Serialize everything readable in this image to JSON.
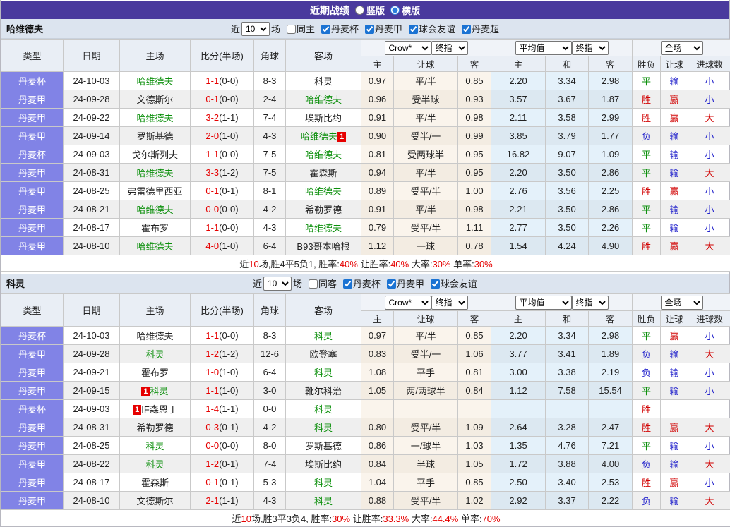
{
  "title_bar": {
    "title": "近期战绩",
    "options": [
      {
        "label": "竖版",
        "selected": false
      },
      {
        "label": "横版",
        "selected": true
      }
    ]
  },
  "colors": {
    "title_bg": "#4a3a9d",
    "section_bar_bg": "#dce4ef",
    "type_cell_bg": "#8183e6",
    "team_green": "#0b8f0b",
    "win_red": "#d10000",
    "loss_blue": "#2525cc",
    "score_red": "#e60000"
  },
  "table_header": {
    "cols": [
      "类型",
      "日期",
      "主场",
      "比分(半场)",
      "角球",
      "客场"
    ],
    "sub": [
      "主",
      "让球",
      "客",
      "主",
      "和",
      "客",
      "胜负",
      "让球",
      "进球数"
    ],
    "selects": {
      "bookmaker": "Crow*",
      "final1": "终指",
      "average": "平均值",
      "final2": "终指",
      "scope": "全场"
    }
  },
  "sections": [
    {
      "team": "哈维德夫",
      "filter": {
        "prefix": "近",
        "count": "10",
        "suffix": "场",
        "same": {
          "label": "同主",
          "checked": false
        },
        "leagues": [
          {
            "label": "丹麦杯",
            "checked": true
          },
          {
            "label": "丹麦甲",
            "checked": true
          },
          {
            "label": "球会友谊",
            "checked": true
          },
          {
            "label": "丹麦超",
            "checked": true
          }
        ]
      },
      "rows": [
        {
          "league": "丹麦杯",
          "date": "24-10-03",
          "home": "哈维德夫",
          "home_active": true,
          "home_badge_before": "",
          "home_badge_after": "",
          "score_ft": "1-1",
          "score_ht": "(0-0)",
          "corners": "8-3",
          "away": "科灵",
          "away_active": false,
          "away_badge_after": "",
          "odds": [
            "0.97",
            "平/半",
            "0.85",
            "2.20",
            "3.34",
            "2.98"
          ],
          "results": [
            {
              "text": "平",
              "color": "green"
            },
            {
              "text": "输",
              "color": "blue"
            },
            {
              "text": "小",
              "color": "blue"
            }
          ]
        },
        {
          "league": "丹麦甲",
          "date": "24-09-28",
          "home": "文德斯尔",
          "home_active": false,
          "home_badge_before": "",
          "home_badge_after": "",
          "score_ft": "0-1",
          "score_ht": "(0-0)",
          "corners": "2-4",
          "away": "哈维德夫",
          "away_active": true,
          "away_badge_after": "",
          "odds": [
            "0.96",
            "受半球",
            "0.93",
            "3.57",
            "3.67",
            "1.87"
          ],
          "results": [
            {
              "text": "胜",
              "color": "red"
            },
            {
              "text": "赢",
              "color": "red"
            },
            {
              "text": "小",
              "color": "blue"
            }
          ]
        },
        {
          "league": "丹麦甲",
          "date": "24-09-22",
          "home": "哈维德夫",
          "home_active": true,
          "home_badge_before": "",
          "home_badge_after": "",
          "score_ft": "3-2",
          "score_ht": "(1-1)",
          "corners": "7-4",
          "away": "埃斯比约",
          "away_active": false,
          "away_badge_after": "",
          "odds": [
            "0.91",
            "平/半",
            "0.98",
            "2.11",
            "3.58",
            "2.99"
          ],
          "results": [
            {
              "text": "胜",
              "color": "red"
            },
            {
              "text": "赢",
              "color": "red"
            },
            {
              "text": "大",
              "color": "red"
            }
          ]
        },
        {
          "league": "丹麦甲",
          "date": "24-09-14",
          "home": "罗斯基德",
          "home_active": false,
          "home_badge_before": "",
          "home_badge_after": "",
          "score_ft": "2-0",
          "score_ht": "(1-0)",
          "corners": "4-3",
          "away": "哈维德夫",
          "away_active": true,
          "away_badge_after": "1",
          "odds": [
            "0.90",
            "受半/一",
            "0.99",
            "3.85",
            "3.79",
            "1.77"
          ],
          "results": [
            {
              "text": "负",
              "color": "blue"
            },
            {
              "text": "输",
              "color": "blue"
            },
            {
              "text": "小",
              "color": "blue"
            }
          ]
        },
        {
          "league": "丹麦杯",
          "date": "24-09-03",
          "home": "戈尔斯列夫",
          "home_active": false,
          "home_badge_before": "",
          "home_badge_after": "",
          "score_ft": "1-1",
          "score_ht": "(0-0)",
          "corners": "7-5",
          "away": "哈维德夫",
          "away_active": true,
          "away_badge_after": "",
          "odds": [
            "0.81",
            "受两球半",
            "0.95",
            "16.82",
            "9.07",
            "1.09"
          ],
          "results": [
            {
              "text": "平",
              "color": "green"
            },
            {
              "text": "输",
              "color": "blue"
            },
            {
              "text": "小",
              "color": "blue"
            }
          ]
        },
        {
          "league": "丹麦甲",
          "date": "24-08-31",
          "home": "哈维德夫",
          "home_active": true,
          "home_badge_before": "",
          "home_badge_after": "",
          "score_ft": "3-3",
          "score_ht": "(1-2)",
          "corners": "7-5",
          "away": "霍森斯",
          "away_active": false,
          "away_badge_after": "",
          "odds": [
            "0.94",
            "平/半",
            "0.95",
            "2.20",
            "3.50",
            "2.86"
          ],
          "results": [
            {
              "text": "平",
              "color": "green"
            },
            {
              "text": "输",
              "color": "blue"
            },
            {
              "text": "大",
              "color": "red"
            }
          ]
        },
        {
          "league": "丹麦甲",
          "date": "24-08-25",
          "home": "弗雷德里西亚",
          "home_active": false,
          "home_badge_before": "",
          "home_badge_after": "",
          "score_ft": "0-1",
          "score_ht": "(0-1)",
          "corners": "8-1",
          "away": "哈维德夫",
          "away_active": true,
          "away_badge_after": "",
          "odds": [
            "0.89",
            "受平/半",
            "1.00",
            "2.76",
            "3.56",
            "2.25"
          ],
          "results": [
            {
              "text": "胜",
              "color": "red"
            },
            {
              "text": "赢",
              "color": "red"
            },
            {
              "text": "小",
              "color": "blue"
            }
          ]
        },
        {
          "league": "丹麦甲",
          "date": "24-08-21",
          "home": "哈维德夫",
          "home_active": true,
          "home_badge_before": "",
          "home_badge_after": "",
          "score_ft": "0-0",
          "score_ht": "(0-0)",
          "corners": "4-2",
          "away": "希勒罗德",
          "away_active": false,
          "away_badge_after": "",
          "odds": [
            "0.91",
            "平/半",
            "0.98",
            "2.21",
            "3.50",
            "2.86"
          ],
          "results": [
            {
              "text": "平",
              "color": "green"
            },
            {
              "text": "输",
              "color": "blue"
            },
            {
              "text": "小",
              "color": "blue"
            }
          ]
        },
        {
          "league": "丹麦甲",
          "date": "24-08-17",
          "home": "霍布罗",
          "home_active": false,
          "home_badge_before": "",
          "home_badge_after": "",
          "score_ft": "1-1",
          "score_ht": "(0-0)",
          "corners": "4-3",
          "away": "哈维德夫",
          "away_active": true,
          "away_badge_after": "",
          "odds": [
            "0.79",
            "受平/半",
            "1.11",
            "2.77",
            "3.50",
            "2.26"
          ],
          "results": [
            {
              "text": "平",
              "color": "green"
            },
            {
              "text": "输",
              "color": "blue"
            },
            {
              "text": "小",
              "color": "blue"
            }
          ]
        },
        {
          "league": "丹麦甲",
          "date": "24-08-10",
          "home": "哈维德夫",
          "home_active": true,
          "home_badge_before": "",
          "home_badge_after": "",
          "score_ft": "4-0",
          "score_ht": "(1-0)",
          "corners": "6-4",
          "away": "B93哥本哈根",
          "away_active": false,
          "away_badge_after": "",
          "odds": [
            "1.12",
            "一球",
            "0.78",
            "1.54",
            "4.24",
            "4.90"
          ],
          "results": [
            {
              "text": "胜",
              "color": "red"
            },
            {
              "text": "赢",
              "color": "red"
            },
            {
              "text": "大",
              "color": "red"
            }
          ]
        }
      ],
      "summary": [
        {
          "text": "近",
          "red": false
        },
        {
          "text": "10",
          "red": true
        },
        {
          "text": "场,胜4平5负1, 胜率:",
          "red": false
        },
        {
          "text": "40%",
          "red": true
        },
        {
          "text": " 让胜率:",
          "red": false
        },
        {
          "text": "40%",
          "red": true
        },
        {
          "text": " 大率:",
          "red": false
        },
        {
          "text": "30%",
          "red": true
        },
        {
          "text": " 单率:",
          "red": false
        },
        {
          "text": "30%",
          "red": true
        }
      ]
    },
    {
      "team": "科灵",
      "filter": {
        "prefix": "近",
        "count": "10",
        "suffix": "场",
        "same": {
          "label": "同客",
          "checked": false
        },
        "leagues": [
          {
            "label": "丹麦杯",
            "checked": true
          },
          {
            "label": "丹麦甲",
            "checked": true
          },
          {
            "label": "球会友谊",
            "checked": true
          }
        ]
      },
      "rows": [
        {
          "league": "丹麦杯",
          "date": "24-10-03",
          "home": "哈维德夫",
          "home_active": false,
          "home_badge_before": "",
          "home_badge_after": "",
          "score_ft": "1-1",
          "score_ht": "(0-0)",
          "corners": "8-3",
          "away": "科灵",
          "away_active": true,
          "away_badge_after": "",
          "odds": [
            "0.97",
            "平/半",
            "0.85",
            "2.20",
            "3.34",
            "2.98"
          ],
          "results": [
            {
              "text": "平",
              "color": "green"
            },
            {
              "text": "赢",
              "color": "red"
            },
            {
              "text": "小",
              "color": "blue"
            }
          ]
        },
        {
          "league": "丹麦甲",
          "date": "24-09-28",
          "home": "科灵",
          "home_active": true,
          "home_badge_before": "",
          "home_badge_after": "",
          "score_ft": "1-2",
          "score_ht": "(1-2)",
          "corners": "12-6",
          "away": "欧登塞",
          "away_active": false,
          "away_badge_after": "",
          "odds": [
            "0.83",
            "受半/一",
            "1.06",
            "3.77",
            "3.41",
            "1.89"
          ],
          "results": [
            {
              "text": "负",
              "color": "blue"
            },
            {
              "text": "输",
              "color": "blue"
            },
            {
              "text": "大",
              "color": "red"
            }
          ]
        },
        {
          "league": "丹麦甲",
          "date": "24-09-21",
          "home": "霍布罗",
          "home_active": false,
          "home_badge_before": "",
          "home_badge_after": "",
          "score_ft": "1-0",
          "score_ht": "(1-0)",
          "corners": "6-4",
          "away": "科灵",
          "away_active": true,
          "away_badge_after": "",
          "odds": [
            "1.08",
            "平手",
            "0.81",
            "3.00",
            "3.38",
            "2.19"
          ],
          "results": [
            {
              "text": "负",
              "color": "blue"
            },
            {
              "text": "输",
              "color": "blue"
            },
            {
              "text": "小",
              "color": "blue"
            }
          ]
        },
        {
          "league": "丹麦甲",
          "date": "24-09-15",
          "home": "科灵",
          "home_active": true,
          "home_badge_before": "1",
          "home_badge_after": "",
          "score_ft": "1-1",
          "score_ht": "(1-0)",
          "corners": "3-0",
          "away": "靴尔科治",
          "away_active": false,
          "away_badge_after": "",
          "odds": [
            "1.05",
            "两/两球半",
            "0.84",
            "1.12",
            "7.58",
            "15.54"
          ],
          "results": [
            {
              "text": "平",
              "color": "green"
            },
            {
              "text": "输",
              "color": "blue"
            },
            {
              "text": "小",
              "color": "blue"
            }
          ]
        },
        {
          "league": "丹麦杯",
          "date": "24-09-03",
          "home": "IF森恩丁",
          "home_active": false,
          "home_badge_before": "1",
          "home_badge_after": "",
          "score_ft": "1-4",
          "score_ht": "(1-1)",
          "corners": "0-0",
          "away": "科灵",
          "away_active": true,
          "away_badge_after": "",
          "odds": [
            "",
            "",
            "",
            "",
            "",
            ""
          ],
          "results": [
            {
              "text": "胜",
              "color": "red"
            },
            {
              "text": "",
              "color": ""
            },
            {
              "text": "",
              "color": ""
            }
          ]
        },
        {
          "league": "丹麦甲",
          "date": "24-08-31",
          "home": "希勒罗德",
          "home_active": false,
          "home_badge_before": "",
          "home_badge_after": "",
          "score_ft": "0-3",
          "score_ht": "(0-1)",
          "corners": "4-2",
          "away": "科灵",
          "away_active": true,
          "away_badge_after": "",
          "odds": [
            "0.80",
            "受平/半",
            "1.09",
            "2.64",
            "3.28",
            "2.47"
          ],
          "results": [
            {
              "text": "胜",
              "color": "red"
            },
            {
              "text": "赢",
              "color": "red"
            },
            {
              "text": "大",
              "color": "red"
            }
          ]
        },
        {
          "league": "丹麦甲",
          "date": "24-08-25",
          "home": "科灵",
          "home_active": true,
          "home_badge_before": "",
          "home_badge_after": "",
          "score_ft": "0-0",
          "score_ht": "(0-0)",
          "corners": "8-0",
          "away": "罗斯基德",
          "away_active": false,
          "away_badge_after": "",
          "odds": [
            "0.86",
            "一/球半",
            "1.03",
            "1.35",
            "4.76",
            "7.21"
          ],
          "results": [
            {
              "text": "平",
              "color": "green"
            },
            {
              "text": "输",
              "color": "blue"
            },
            {
              "text": "小",
              "color": "blue"
            }
          ]
        },
        {
          "league": "丹麦甲",
          "date": "24-08-22",
          "home": "科灵",
          "home_active": true,
          "home_badge_before": "",
          "home_badge_after": "",
          "score_ft": "1-2",
          "score_ht": "(0-1)",
          "corners": "7-4",
          "away": "埃斯比约",
          "away_active": false,
          "away_badge_after": "",
          "odds": [
            "0.84",
            "半球",
            "1.05",
            "1.72",
            "3.88",
            "4.00"
          ],
          "results": [
            {
              "text": "负",
              "color": "blue"
            },
            {
              "text": "输",
              "color": "blue"
            },
            {
              "text": "大",
              "color": "red"
            }
          ]
        },
        {
          "league": "丹麦甲",
          "date": "24-08-17",
          "home": "霍森斯",
          "home_active": false,
          "home_badge_before": "",
          "home_badge_after": "",
          "score_ft": "0-1",
          "score_ht": "(0-1)",
          "corners": "5-3",
          "away": "科灵",
          "away_active": true,
          "away_badge_after": "",
          "odds": [
            "1.04",
            "平手",
            "0.85",
            "2.50",
            "3.40",
            "2.53"
          ],
          "results": [
            {
              "text": "胜",
              "color": "red"
            },
            {
              "text": "赢",
              "color": "red"
            },
            {
              "text": "小",
              "color": "blue"
            }
          ]
        },
        {
          "league": "丹麦甲",
          "date": "24-08-10",
          "home": "文德斯尔",
          "home_active": false,
          "home_badge_before": "",
          "home_badge_after": "",
          "score_ft": "2-1",
          "score_ht": "(1-1)",
          "corners": "4-3",
          "away": "科灵",
          "away_active": true,
          "away_badge_after": "",
          "odds": [
            "0.88",
            "受平/半",
            "1.02",
            "2.92",
            "3.37",
            "2.22"
          ],
          "results": [
            {
              "text": "负",
              "color": "blue"
            },
            {
              "text": "输",
              "color": "blue"
            },
            {
              "text": "大",
              "color": "red"
            }
          ]
        }
      ],
      "summary": [
        {
          "text": "近",
          "red": false
        },
        {
          "text": "10",
          "red": true
        },
        {
          "text": "场,胜3平3负4, 胜率:",
          "red": false
        },
        {
          "text": "30%",
          "red": true
        },
        {
          "text": " 让胜率:",
          "red": false
        },
        {
          "text": "33.3%",
          "red": true
        },
        {
          "text": " 大率:",
          "red": false
        },
        {
          "text": "44.4%",
          "red": true
        },
        {
          "text": " 单率:",
          "red": false
        },
        {
          "text": "70%",
          "red": true
        }
      ]
    }
  ]
}
